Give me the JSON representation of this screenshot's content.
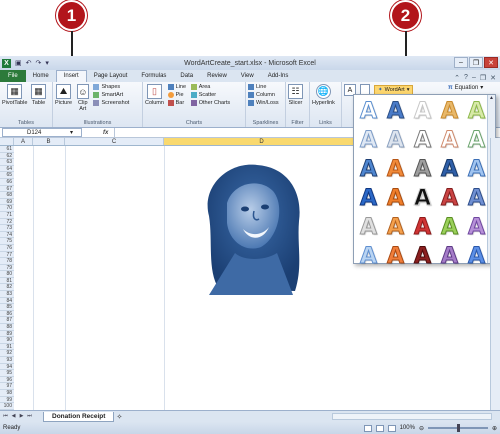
{
  "callouts": [
    {
      "num": "1"
    },
    {
      "num": "2"
    }
  ],
  "window": {
    "title": "WordArtCreate_start.xlsx - Microsoft Excel",
    "app_icon": "X"
  },
  "tabs": {
    "file": "File",
    "items": [
      "Home",
      "Insert",
      "Page Layout",
      "Formulas",
      "Data",
      "Review",
      "View",
      "Add-Ins"
    ],
    "active": "Insert"
  },
  "ribbon": {
    "tables": {
      "pivot": "PivotTable",
      "table": "Table",
      "label": "Tables"
    },
    "illustrations": {
      "picture": "Picture",
      "clipart": "Clip Art",
      "shapes": "Shapes",
      "smartart": "SmartArt",
      "screenshot": "Screenshot",
      "label": "Illustrations"
    },
    "charts": {
      "column": "Column",
      "line": "Line",
      "pie": "Pie",
      "bar": "Bar",
      "area": "Area",
      "scatter": "Scatter",
      "other": "Other Charts",
      "label": "Charts"
    },
    "sparklines": {
      "line": "Line",
      "column": "Column",
      "winloss": "Win/Loss",
      "label": "Sparklines"
    },
    "filter": {
      "slicer": "Slicer",
      "label": "Filter"
    },
    "links": {
      "hyperlink": "Hyperlink",
      "label": "Links"
    },
    "text": {
      "wordart": "WordArt",
      "equation": "Equation"
    }
  },
  "formula_bar": {
    "name_box": "D124",
    "fx": "fx",
    "value": ""
  },
  "columns": [
    "A",
    "B",
    "C",
    "D"
  ],
  "rows": [
    "61",
    "62",
    "63",
    "64",
    "65",
    "66",
    "67",
    "68",
    "69",
    "70",
    "71",
    "72",
    "73",
    "74",
    "75",
    "76",
    "77",
    "78",
    "79",
    "80",
    "81",
    "82",
    "83",
    "84",
    "85",
    "86",
    "87",
    "88",
    "89",
    "90",
    "91",
    "92",
    "93",
    "94",
    "95",
    "96",
    "97",
    "98",
    "99",
    "100"
  ],
  "sheet": {
    "tab": "Donation Receipt"
  },
  "status": {
    "ready": "Ready",
    "zoom": "100%"
  },
  "wordart_gallery": {
    "glyph": "A",
    "styles": [
      {
        "fill": "#ffffff",
        "stroke": "#5b8fd0"
      },
      {
        "fill": "#4a7bc8",
        "stroke": "#2c4f86"
      },
      {
        "fill": "#ffffff",
        "stroke": "#c8c8c8"
      },
      {
        "fill": "#e8b86a",
        "stroke": "#c98a2c"
      },
      {
        "fill": "#d7e9a8",
        "stroke": "#8cb84a"
      },
      {
        "fill": "#dfe8f4",
        "stroke": "#7c9cc8"
      },
      {
        "fill": "#dde4ee",
        "stroke": "#8aa0bf"
      },
      {
        "fill": "#ffffff",
        "stroke": "#7a7a7a"
      },
      {
        "fill": "#ffffff",
        "stroke": "#d08a6c"
      },
      {
        "fill": "#ffffff",
        "stroke": "#6aa36c"
      },
      {
        "fill": "#4f86d0",
        "stroke": "#1e3f74"
      },
      {
        "fill": "#f08a3a",
        "stroke": "#b65515"
      },
      {
        "fill": "#9e9e9e",
        "stroke": "#555555"
      },
      {
        "fill": "#2f5fa8",
        "stroke": "#163767"
      },
      {
        "fill": "#a0c4f0",
        "stroke": "#3c6fb6"
      },
      {
        "fill": "#2b68c7",
        "stroke": "#0f3680"
      },
      {
        "fill": "#ef7e2a",
        "stroke": "#a84c10"
      },
      {
        "fill": "#111111",
        "stroke": "#d0d0d0"
      },
      {
        "fill": "#c94343",
        "stroke": "#821d1d"
      },
      {
        "fill": "#6f8fd2",
        "stroke": "#2d4d8a"
      },
      {
        "fill": "#e0e0e0",
        "stroke": "#9a9a9a"
      },
      {
        "fill": "#f4a04c",
        "stroke": "#b2601e"
      },
      {
        "fill": "#cf3434",
        "stroke": "#8f1a1a"
      },
      {
        "fill": "#9ad05a",
        "stroke": "#5a8e22"
      },
      {
        "fill": "#b790d8",
        "stroke": "#6f47a0"
      },
      {
        "fill": "#b9d4f2",
        "stroke": "#5f8fd0"
      },
      {
        "fill": "#f07d3a",
        "stroke": "#a94a13"
      },
      {
        "fill": "#8b1f1f",
        "stroke": "#4e0c0c"
      },
      {
        "fill": "#a57cc8",
        "stroke": "#5d3a86"
      },
      {
        "fill": "#5c8fe6",
        "stroke": "#2a58aa"
      }
    ]
  }
}
